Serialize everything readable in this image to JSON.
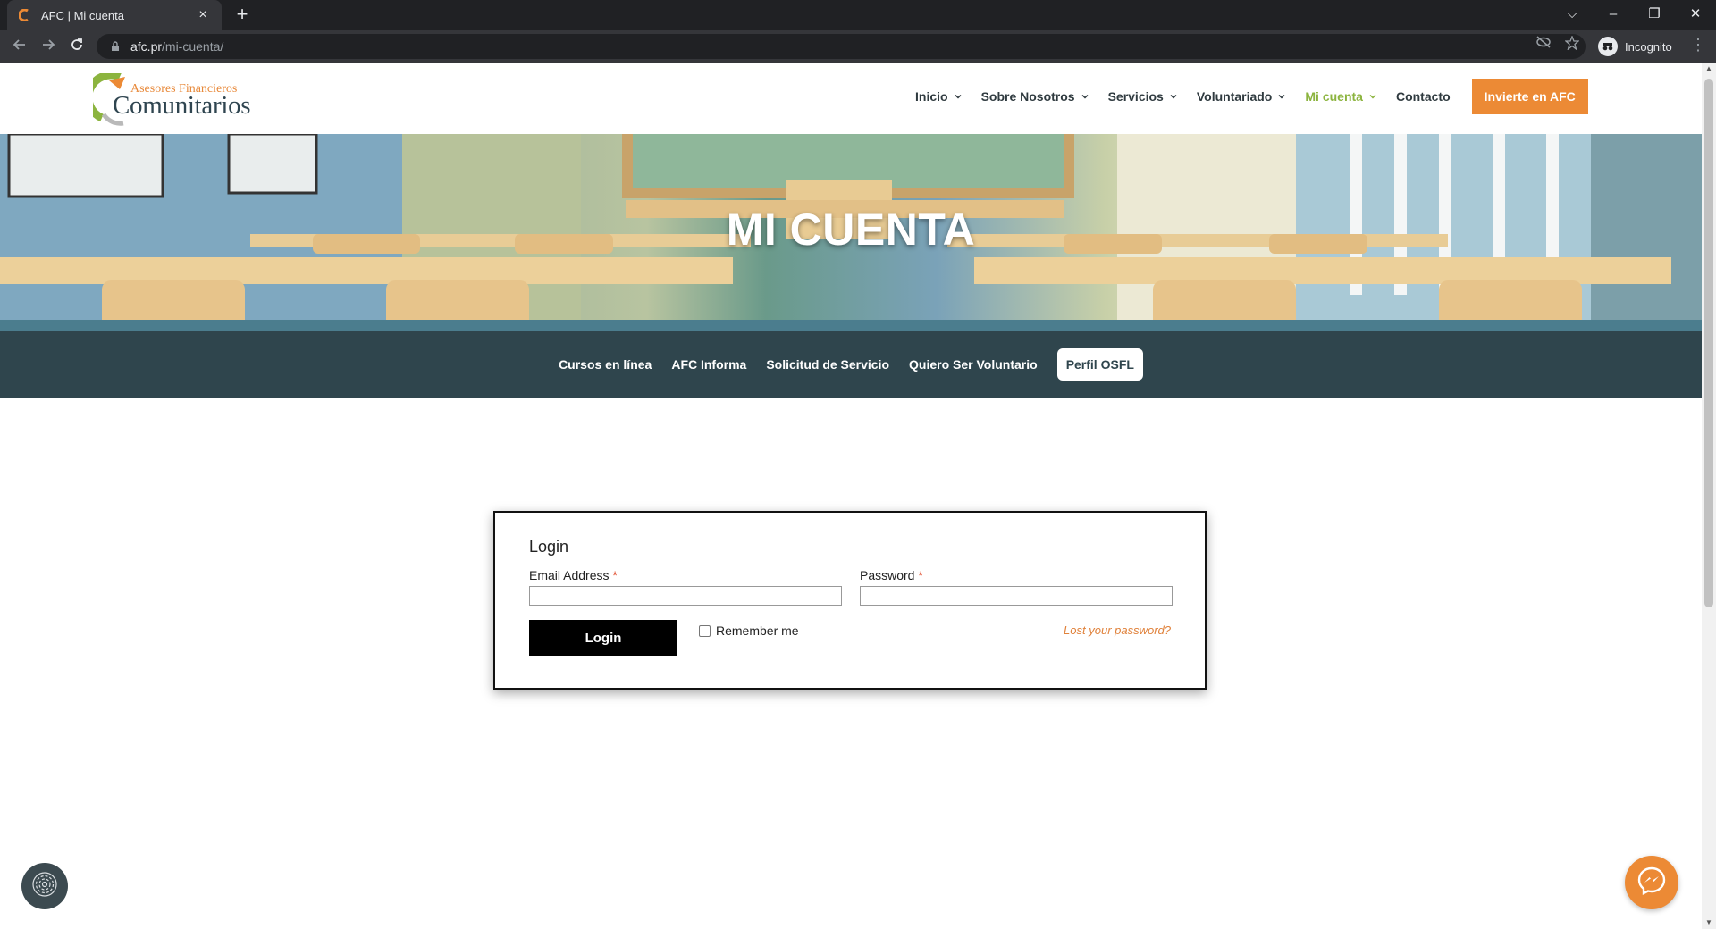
{
  "browser": {
    "tab_title": "AFC | Mi cuenta",
    "tab_close": "×",
    "new_tab": "+",
    "url_host": "afc.pr",
    "url_path": "/mi-cuenta/",
    "incognito_label": "Incognito",
    "window_controls": [
      "⌵",
      "–",
      "❐",
      "✕"
    ]
  },
  "site": {
    "logo_top": "Asesores Financieros",
    "logo_main": "Comunitarios",
    "nav": [
      {
        "label": "Inicio",
        "dropdown": true
      },
      {
        "label": "Sobre Nosotros",
        "dropdown": true
      },
      {
        "label": "Servicios",
        "dropdown": true
      },
      {
        "label": "Voluntariado",
        "dropdown": true
      },
      {
        "label": "Mi cuenta",
        "dropdown": true,
        "active": true
      },
      {
        "label": "Contacto",
        "dropdown": false
      }
    ],
    "cta_label": "Invierte en AFC",
    "accent_color": "#8cb43f",
    "cta_color": "#ec8a35"
  },
  "hero": {
    "title": "MI CUENTA"
  },
  "subnav": {
    "items": [
      "Cursos en línea",
      "AFC Informa",
      "Solicitud de Servicio",
      "Quiero Ser Voluntario"
    ],
    "pill_label": "Perfil OSFL"
  },
  "login": {
    "title": "Login",
    "email_label": "Email Address",
    "password_label": "Password",
    "required_mark": "*",
    "email_value": "",
    "password_value": "",
    "button_label": "Login",
    "remember_label": "Remember me",
    "remember_checked": false,
    "lost_password_label": "Lost your password?"
  },
  "widgets": {
    "accessibility_icon": "fingerprint-icon",
    "messenger_icon": "messenger-icon"
  }
}
